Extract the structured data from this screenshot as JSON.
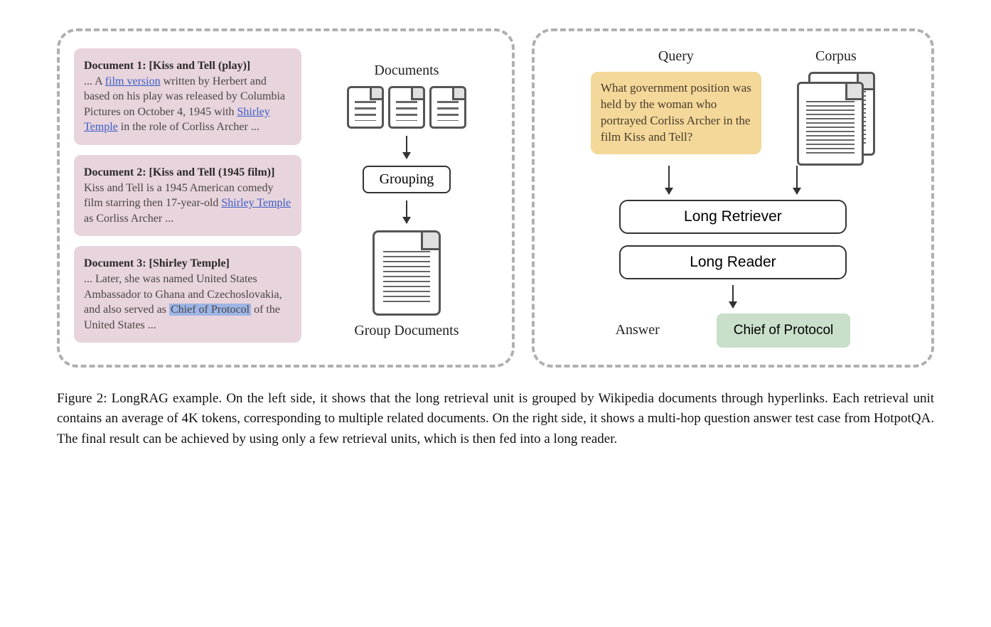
{
  "left": {
    "doc1": {
      "title": "Document 1: [Kiss and Tell (play)]",
      "pre": "... A ",
      "link1": "film version",
      "mid": " written by Herbert and based on his play was released by Columbia Pictures on October 4, 1945 with ",
      "link2": "Shirley Temple",
      "post": " in the role of Corliss Archer ..."
    },
    "doc2": {
      "title": "Document 2: [Kiss and Tell (1945 film)]",
      "pre": "Kiss and Tell is a 1945 American comedy film starring then 17-year-old ",
      "link1": "Shirley Temple",
      "post": " as Corliss Archer ..."
    },
    "doc3": {
      "title": "Document 3: [Shirley Temple]",
      "pre": "... Later, she was named United States Ambassador to Ghana and Czechoslovakia, and also served as ",
      "hl": "Chief of Protocol",
      "post": " of the United States ..."
    },
    "documents_label": "Documents",
    "grouping_label": "Grouping",
    "group_documents_label": "Group Documents"
  },
  "right": {
    "query_label": "Query",
    "corpus_label": "Corpus",
    "query_text": "What government position was held by the woman who portrayed Corliss Archer in the film Kiss and Tell?",
    "long_retriever": "Long Retriever",
    "long_reader": "Long Reader",
    "answer_label": "Answer",
    "answer_text": "Chief of Protocol"
  },
  "caption": "Figure 2: LongRAG example. On the left side, it shows that the long retrieval unit is grouped by Wikipedia documents through hyperlinks. Each retrieval unit contains an average of 4K tokens, corresponding to multiple related documents. On the right side, it shows a multi-hop question answer test case from HotpotQA. The final result can be achieved by using only a few retrieval units, which is then fed into a long reader."
}
